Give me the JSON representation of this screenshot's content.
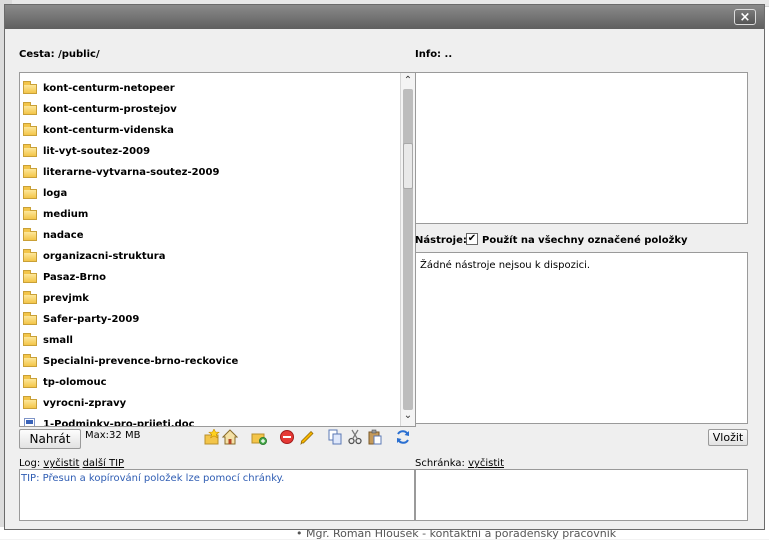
{
  "background": {
    "footer_text": "• Mgr. Roman Hloušek - kontaktní a poradenský pracovník"
  },
  "dialog": {
    "close_label": "×"
  },
  "path": {
    "label": "Cesta:",
    "value": "/public/"
  },
  "info": {
    "label": "Info:",
    "value": ".."
  },
  "files": [
    {
      "name": "kont-centurm-netopeer",
      "type": "folder"
    },
    {
      "name": "kont-centurm-prostejov",
      "type": "folder"
    },
    {
      "name": "kont-centurm-videnska",
      "type": "folder"
    },
    {
      "name": "lit-vyt-soutez-2009",
      "type": "folder"
    },
    {
      "name": "literarne-vytvarna-soutez-2009",
      "type": "folder"
    },
    {
      "name": "loga",
      "type": "folder"
    },
    {
      "name": "medium",
      "type": "folder"
    },
    {
      "name": "nadace",
      "type": "folder"
    },
    {
      "name": "organizacni-struktura",
      "type": "folder"
    },
    {
      "name": "Pasaz-Brno",
      "type": "folder"
    },
    {
      "name": "prevjmk",
      "type": "folder"
    },
    {
      "name": "Safer-party-2009",
      "type": "folder"
    },
    {
      "name": "small",
      "type": "folder"
    },
    {
      "name": "Specialni-prevence-brno-reckovice",
      "type": "folder"
    },
    {
      "name": "tp-olomouc",
      "type": "folder"
    },
    {
      "name": "vyrocni-zpravy",
      "type": "folder"
    },
    {
      "name": "1-Podminky-pro-prijeti.doc",
      "type": "doc"
    }
  ],
  "upload": {
    "button_label": "Nahrát",
    "max_size": "Max:32 MB"
  },
  "toolbar_icons": [
    "new-folder-star-icon",
    "home-icon",
    "add-folder-icon",
    "delete-icon",
    "rename-pencil-icon",
    "copy-icon",
    "cut-icon",
    "paste-icon",
    "refresh-icon"
  ],
  "tools": {
    "label": "Nástroje:",
    "apply_all_label": "Použít na všechny označené položky",
    "apply_all_checked": true,
    "empty_text": "Žádné nástroje nejsou k dispozici.",
    "insert_button": "Vložit"
  },
  "log": {
    "label": "Log:",
    "clear_link": "vyčistit",
    "next_tip_link": "další TIP",
    "message": "TIP: Přesun a kopírování položek lze pomocí chránky."
  },
  "clipboard": {
    "label": "Schránka:",
    "clear_link": "vyčistit"
  },
  "colors": {
    "tip_text": "#2f5db3",
    "titlebar": "#6e6e6e"
  }
}
